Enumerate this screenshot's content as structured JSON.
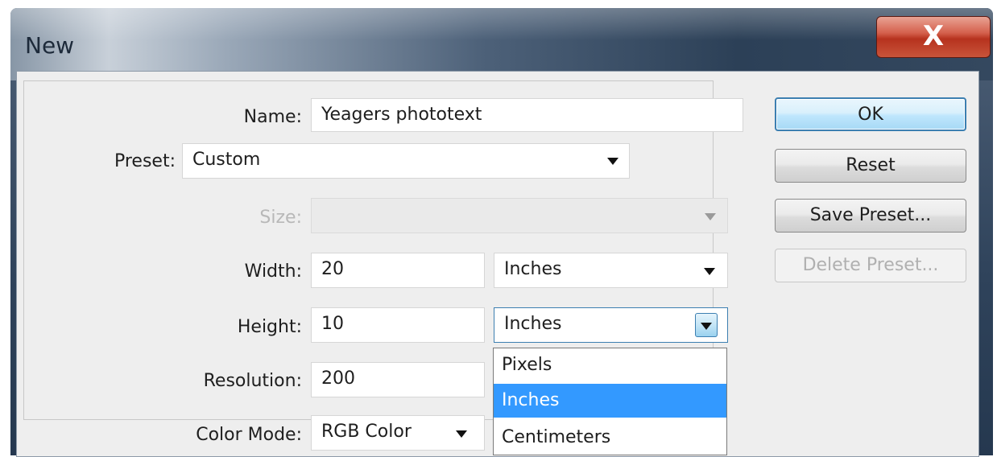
{
  "window": {
    "title": "New",
    "close_glyph": "X"
  },
  "form": {
    "name_label": "Name:",
    "name_value": "Yeagers phototext",
    "preset_label": "Preset:",
    "preset_value": "Custom",
    "size_label": "Size:",
    "size_value": "",
    "width_label": "Width:",
    "width_value": "20",
    "width_unit": "Inches",
    "height_label": "Height:",
    "height_value": "10",
    "height_unit": "Inches",
    "resolution_label": "Resolution:",
    "resolution_value": "200",
    "color_mode_label": "Color Mode:",
    "color_mode_value": "RGB Color"
  },
  "buttons": {
    "ok": "OK",
    "reset": "Reset",
    "save_preset": "Save Preset...",
    "delete_preset": "Delete Preset..."
  },
  "unit_dropdown": {
    "options": [
      "Pixels",
      "Inches",
      "Centimeters"
    ],
    "selected": "Inches"
  },
  "colors": {
    "selection": "#3399ff",
    "default_button_border": "#3c7fb1",
    "close_button": "#c9452f"
  },
  "icons": {
    "close": "close-icon",
    "dropdown": "chevron-down-icon"
  }
}
